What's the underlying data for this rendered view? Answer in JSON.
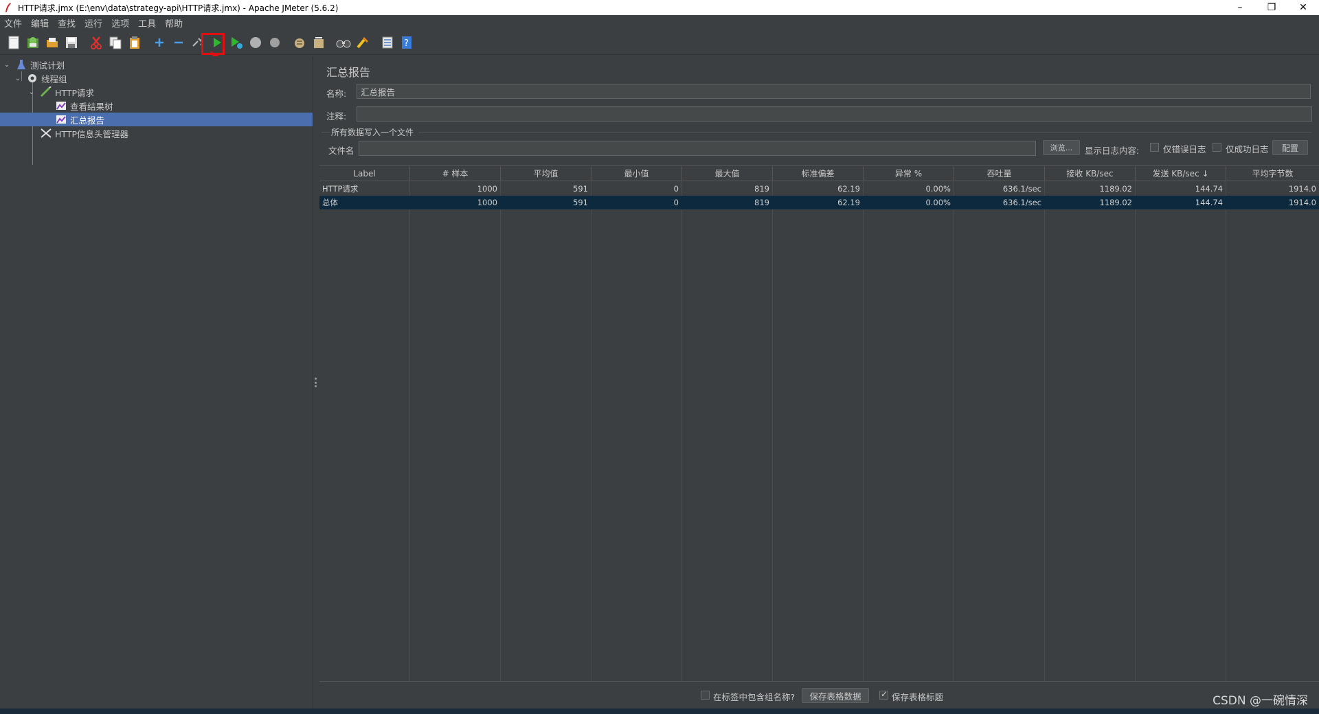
{
  "window": {
    "title": "HTTP请求.jmx (E:\\env\\data\\strategy-api\\HTTP请求.jmx) - Apache JMeter (5.6.2)",
    "minimize": "–",
    "restore": "❐",
    "close": "✕"
  },
  "menu": [
    "文件",
    "编辑",
    "查找",
    "运行",
    "选项",
    "工具",
    "帮助"
  ],
  "toolbar": {
    "icons": [
      "new-icon",
      "templates-icon",
      "open-icon",
      "save-icon",
      "cut-icon",
      "copy-icon",
      "paste-icon",
      "expand-icon",
      "collapse-icon",
      "toggle-icon",
      "start-icon",
      "start-no-pause-icon",
      "stop-icon",
      "shutdown-icon",
      "clear-icon",
      "clear-all-icon",
      "search-icon",
      "reset-search-icon",
      "function-helper-icon",
      "help-icon"
    ],
    "highlighted": "start-icon"
  },
  "tree": {
    "items": [
      {
        "label": "测试计划",
        "level": 0,
        "icon": "flask-icon",
        "expanded": true
      },
      {
        "label": "线程组",
        "level": 1,
        "icon": "gear-icon",
        "expanded": true
      },
      {
        "label": "HTTP请求",
        "level": 2,
        "icon": "pencil-icon",
        "expanded": true
      },
      {
        "label": "查看结果树",
        "level": 3,
        "icon": "chart-icon"
      },
      {
        "label": "汇总报告",
        "level": 3,
        "icon": "chart-icon",
        "selected": true
      },
      {
        "label": "HTTP信息头管理器",
        "level": 2,
        "icon": "tools-icon"
      }
    ]
  },
  "panel": {
    "title": "汇总报告",
    "name_label": "名称:",
    "name_value": "汇总报告",
    "comment_label": "注释:",
    "comment_value": "",
    "file_group_label": "所有数据写入一个文件",
    "filename_label": "文件名",
    "filename_value": "",
    "browse_button": "浏览...",
    "log_content_label": "显示日志内容:",
    "errors_only_label": "仅错误日志",
    "success_only_label": "仅成功日志",
    "configure_button": "配置"
  },
  "table": {
    "columns": [
      "Label",
      "# 样本",
      "平均值",
      "最小值",
      "最大值",
      "标准偏差",
      "异常 %",
      "吞吐量",
      "接收 KB/sec",
      "发送 KB/sec ↓",
      "平均字节数"
    ],
    "rows": [
      [
        "HTTP请求",
        "1000",
        "591",
        "0",
        "819",
        "62.19",
        "0.00%",
        "636.1/sec",
        "1189.02",
        "144.74",
        "1914.0"
      ],
      [
        "总体",
        "1000",
        "591",
        "0",
        "819",
        "62.19",
        "0.00%",
        "636.1/sec",
        "1189.02",
        "144.74",
        "1914.0"
      ]
    ],
    "selected_row": 1
  },
  "bottom": {
    "include_group_label": "在标签中包含组名称?",
    "include_group_checked": false,
    "save_table_data": "保存表格数据",
    "save_table_header_label": "保存表格标题",
    "save_table_header_checked": true
  },
  "watermark": "CSDN @一碗情深",
  "colors": {
    "background": "#3c3f41",
    "selection": "#4b6eaf",
    "table_selection": "#0d293e",
    "highlight_box": "#e01010"
  }
}
